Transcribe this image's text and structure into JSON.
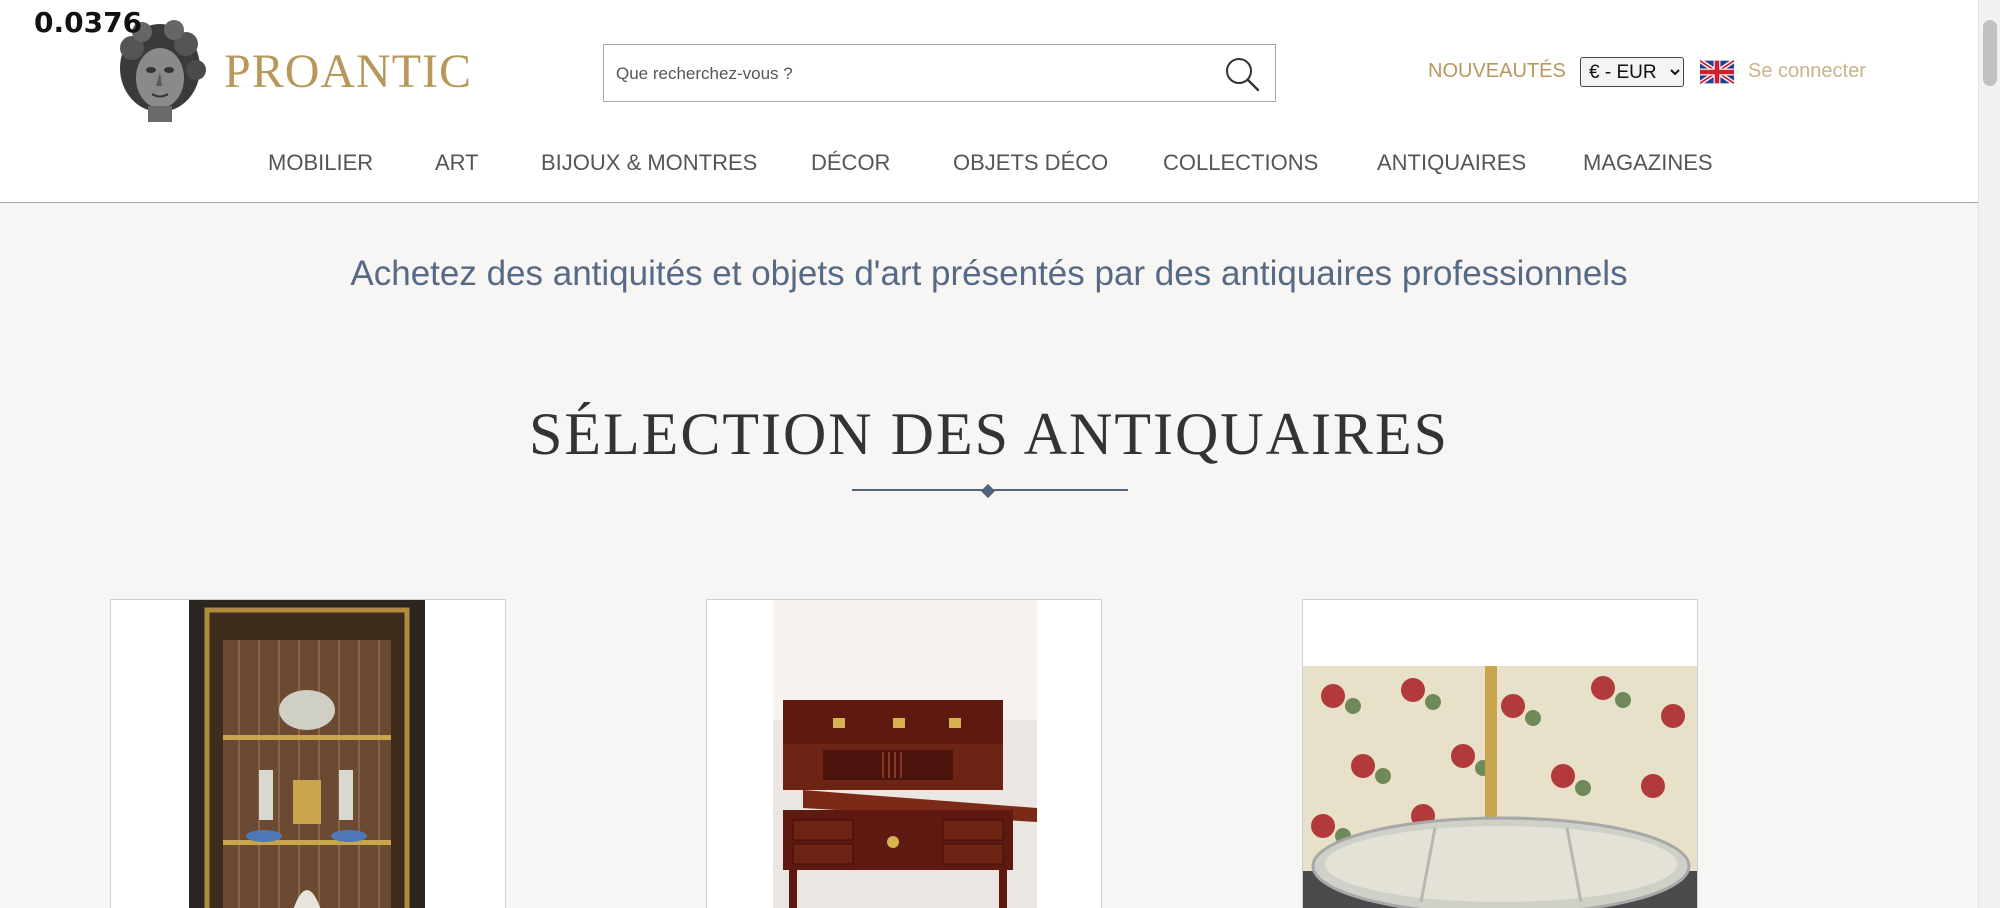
{
  "overlay": {
    "value": "0.0376"
  },
  "brand": {
    "name": "PROANTIC"
  },
  "search": {
    "placeholder": "Que recherchez-vous ?"
  },
  "header_links": {
    "new": "NOUVEAUTÉS",
    "currency_selected": "€ - EUR",
    "login": "Se connecter"
  },
  "nav": {
    "items": [
      {
        "label": "MOBILIER"
      },
      {
        "label": "ART"
      },
      {
        "label": "BIJOUX & MONTRES"
      },
      {
        "label": "DÉCOR"
      },
      {
        "label": "OBJETS DÉCO"
      },
      {
        "label": "COLLECTIONS"
      },
      {
        "label": "ANTIQUAIRES"
      },
      {
        "label": "MAGAZINES"
      }
    ]
  },
  "tagline": "Achetez des antiquités et objets d'art présentés par des antiquaires professionnels",
  "section": {
    "title": "SÉLECTION DES ANTIQUAIRES"
  },
  "products": [
    {
      "image": "vitrine-cabinet-photo"
    },
    {
      "image": "cylinder-desk-photo"
    },
    {
      "image": "mirror-plateau-photo"
    }
  ],
  "colors": {
    "brand_gold": "#b8975a",
    "tagline_blue": "#566a86",
    "divider": "#52637a",
    "page_bg": "#f7f6f4"
  },
  "icons": {
    "search": "search-icon",
    "flag": "uk-flag-icon",
    "logo": "antique-bust-logo"
  }
}
